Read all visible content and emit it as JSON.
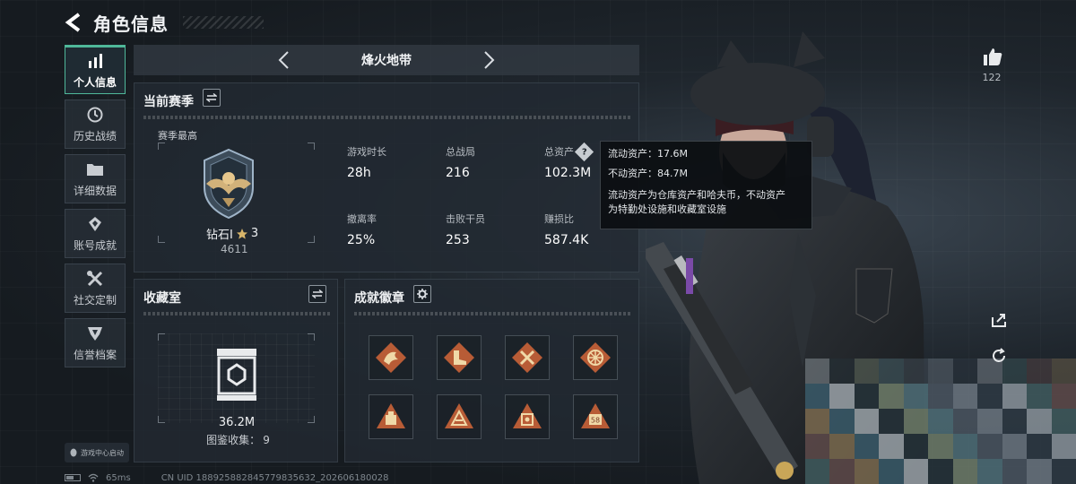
{
  "header": {
    "title": "角色信息"
  },
  "nav": {
    "items": [
      {
        "label": "个人信息",
        "icon": "bar-chart-icon",
        "active": true
      },
      {
        "label": "历史战绩",
        "icon": "clock-icon",
        "active": false
      },
      {
        "label": "详细数据",
        "icon": "folder-icon",
        "active": false
      },
      {
        "label": "账号成就",
        "icon": "achievement-icon",
        "active": false
      },
      {
        "label": "社交定制",
        "icon": "tools-icon",
        "active": false
      },
      {
        "label": "信誉档案",
        "icon": "credit-icon",
        "active": false
      }
    ],
    "launch_tag": "游戏中心启动"
  },
  "mode": {
    "name": "烽火地带"
  },
  "season": {
    "title": "当前赛季",
    "best_label": "赛季最高",
    "rank_name": "钻石I",
    "rank_stars": "3",
    "rank_score": "4611",
    "stats": [
      {
        "label": "游戏时长",
        "value": "28h"
      },
      {
        "label": "总战局",
        "value": "216"
      },
      {
        "label": "总资产",
        "value": "102.3M"
      },
      {
        "label": "撤离率",
        "value": "25%"
      },
      {
        "label": "击败干员",
        "value": "253"
      },
      {
        "label": "赚损比",
        "value": "587.4K"
      }
    ]
  },
  "tooltip": {
    "liquid": "流动资产：17.6M",
    "fixed": "不动资产：84.7M",
    "desc_line1": "流动资产为仓库资产和哈夫币，不动资产",
    "desc_line2": "为特勤处设施和收藏室设施",
    "help_glyph": "?"
  },
  "collection": {
    "title": "收藏室",
    "value": "36.2M",
    "count_label": "图鉴收集：",
    "count": "9"
  },
  "achievements": {
    "title": "成就徽章",
    "badges": [
      "dragon-badge-icon",
      "boot-badge-icon",
      "crossed-tools-badge-icon",
      "wheel-badge-icon",
      "weight-badge-icon",
      "pyramid-badge-icon",
      "frame-badge-icon",
      "number-58-badge-icon"
    ],
    "badge_58_text": "58"
  },
  "social": {
    "likes": "122"
  },
  "footer": {
    "ping": "65ms",
    "uid": "CN UID 1889258828457798356​32_202606180028"
  },
  "colors": {
    "accent": "#4fb89a",
    "badge": "#c0643a",
    "panel": "#222a32"
  }
}
